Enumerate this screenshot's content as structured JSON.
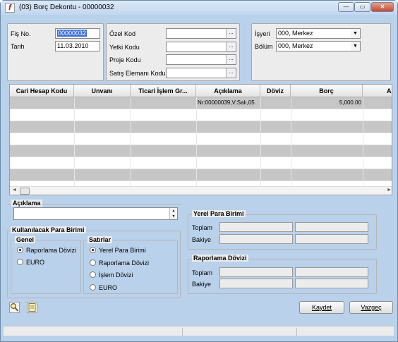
{
  "window": {
    "title": "(03) Borç Dekontu - 00000032",
    "app_icon_glyph": "f",
    "min_glyph": "—",
    "max_glyph": "▭",
    "close_glyph": "✕"
  },
  "header": {
    "fis_no_label": "Fiş No.",
    "fis_no_value": "00000032",
    "tarih_label": "Tarih",
    "tarih_value": "11.03.2010",
    "ozel_kod_label": "Özel Kod",
    "yetki_kodu_label": "Yetki Kodu",
    "proje_kodu_label": "Proje Kodu",
    "satis_elemani_label": "Satış Elemanı Kodu",
    "lookup_glyph": "...",
    "isyeri_label": "İşyeri",
    "isyeri_value": "000, Merkez",
    "bolum_label": "Bölüm",
    "bolum_value": "000, Merkez",
    "dropdown_glyph": "▼"
  },
  "grid": {
    "columns": [
      "Cari Hesap Kodu",
      "Unvanı",
      "Ticari İşlem Gr...",
      "Açıklama",
      "Döviz",
      "Borç",
      "Ala"
    ],
    "rows": [
      {
        "cari": "",
        "unvan": "",
        "ticari": "",
        "aciklama": "Nr:00000039,V:Salı,05",
        "doviz": "",
        "borc": "5,000.00"
      }
    ],
    "scroll_left": "◄",
    "scroll_right": "►"
  },
  "aciklama": {
    "label": "Açıklama",
    "value": "",
    "spin_up": "▲",
    "spin_down": "▼"
  },
  "para_birimi": {
    "title": "Kullanılacak Para Birimi",
    "genel_title": "Genel",
    "genel_options": [
      "Raporlama Dövizi",
      "EURO"
    ],
    "genel_selected": 0,
    "satirlar_title": "Satırlar",
    "satirlar_options": [
      "Yerel Para Birimi",
      "Raporlama Dövizi",
      "İşlem Dövizi",
      "EURO"
    ],
    "satirlar_selected": 0
  },
  "yerel": {
    "title": "Yerel Para Birimi",
    "toplam_label": "Toplam",
    "bakiye_label": "Bakiye"
  },
  "raporlama": {
    "title": "Raporlama Dövizi",
    "toplam_label": "Toplam",
    "bakiye_label": "Bakiye"
  },
  "buttons": {
    "kaydet": "Kaydet",
    "vazgec": "Vazgeç"
  },
  "icons": {
    "tool1": "magnifier-icon",
    "tool2": "note-icon"
  }
}
